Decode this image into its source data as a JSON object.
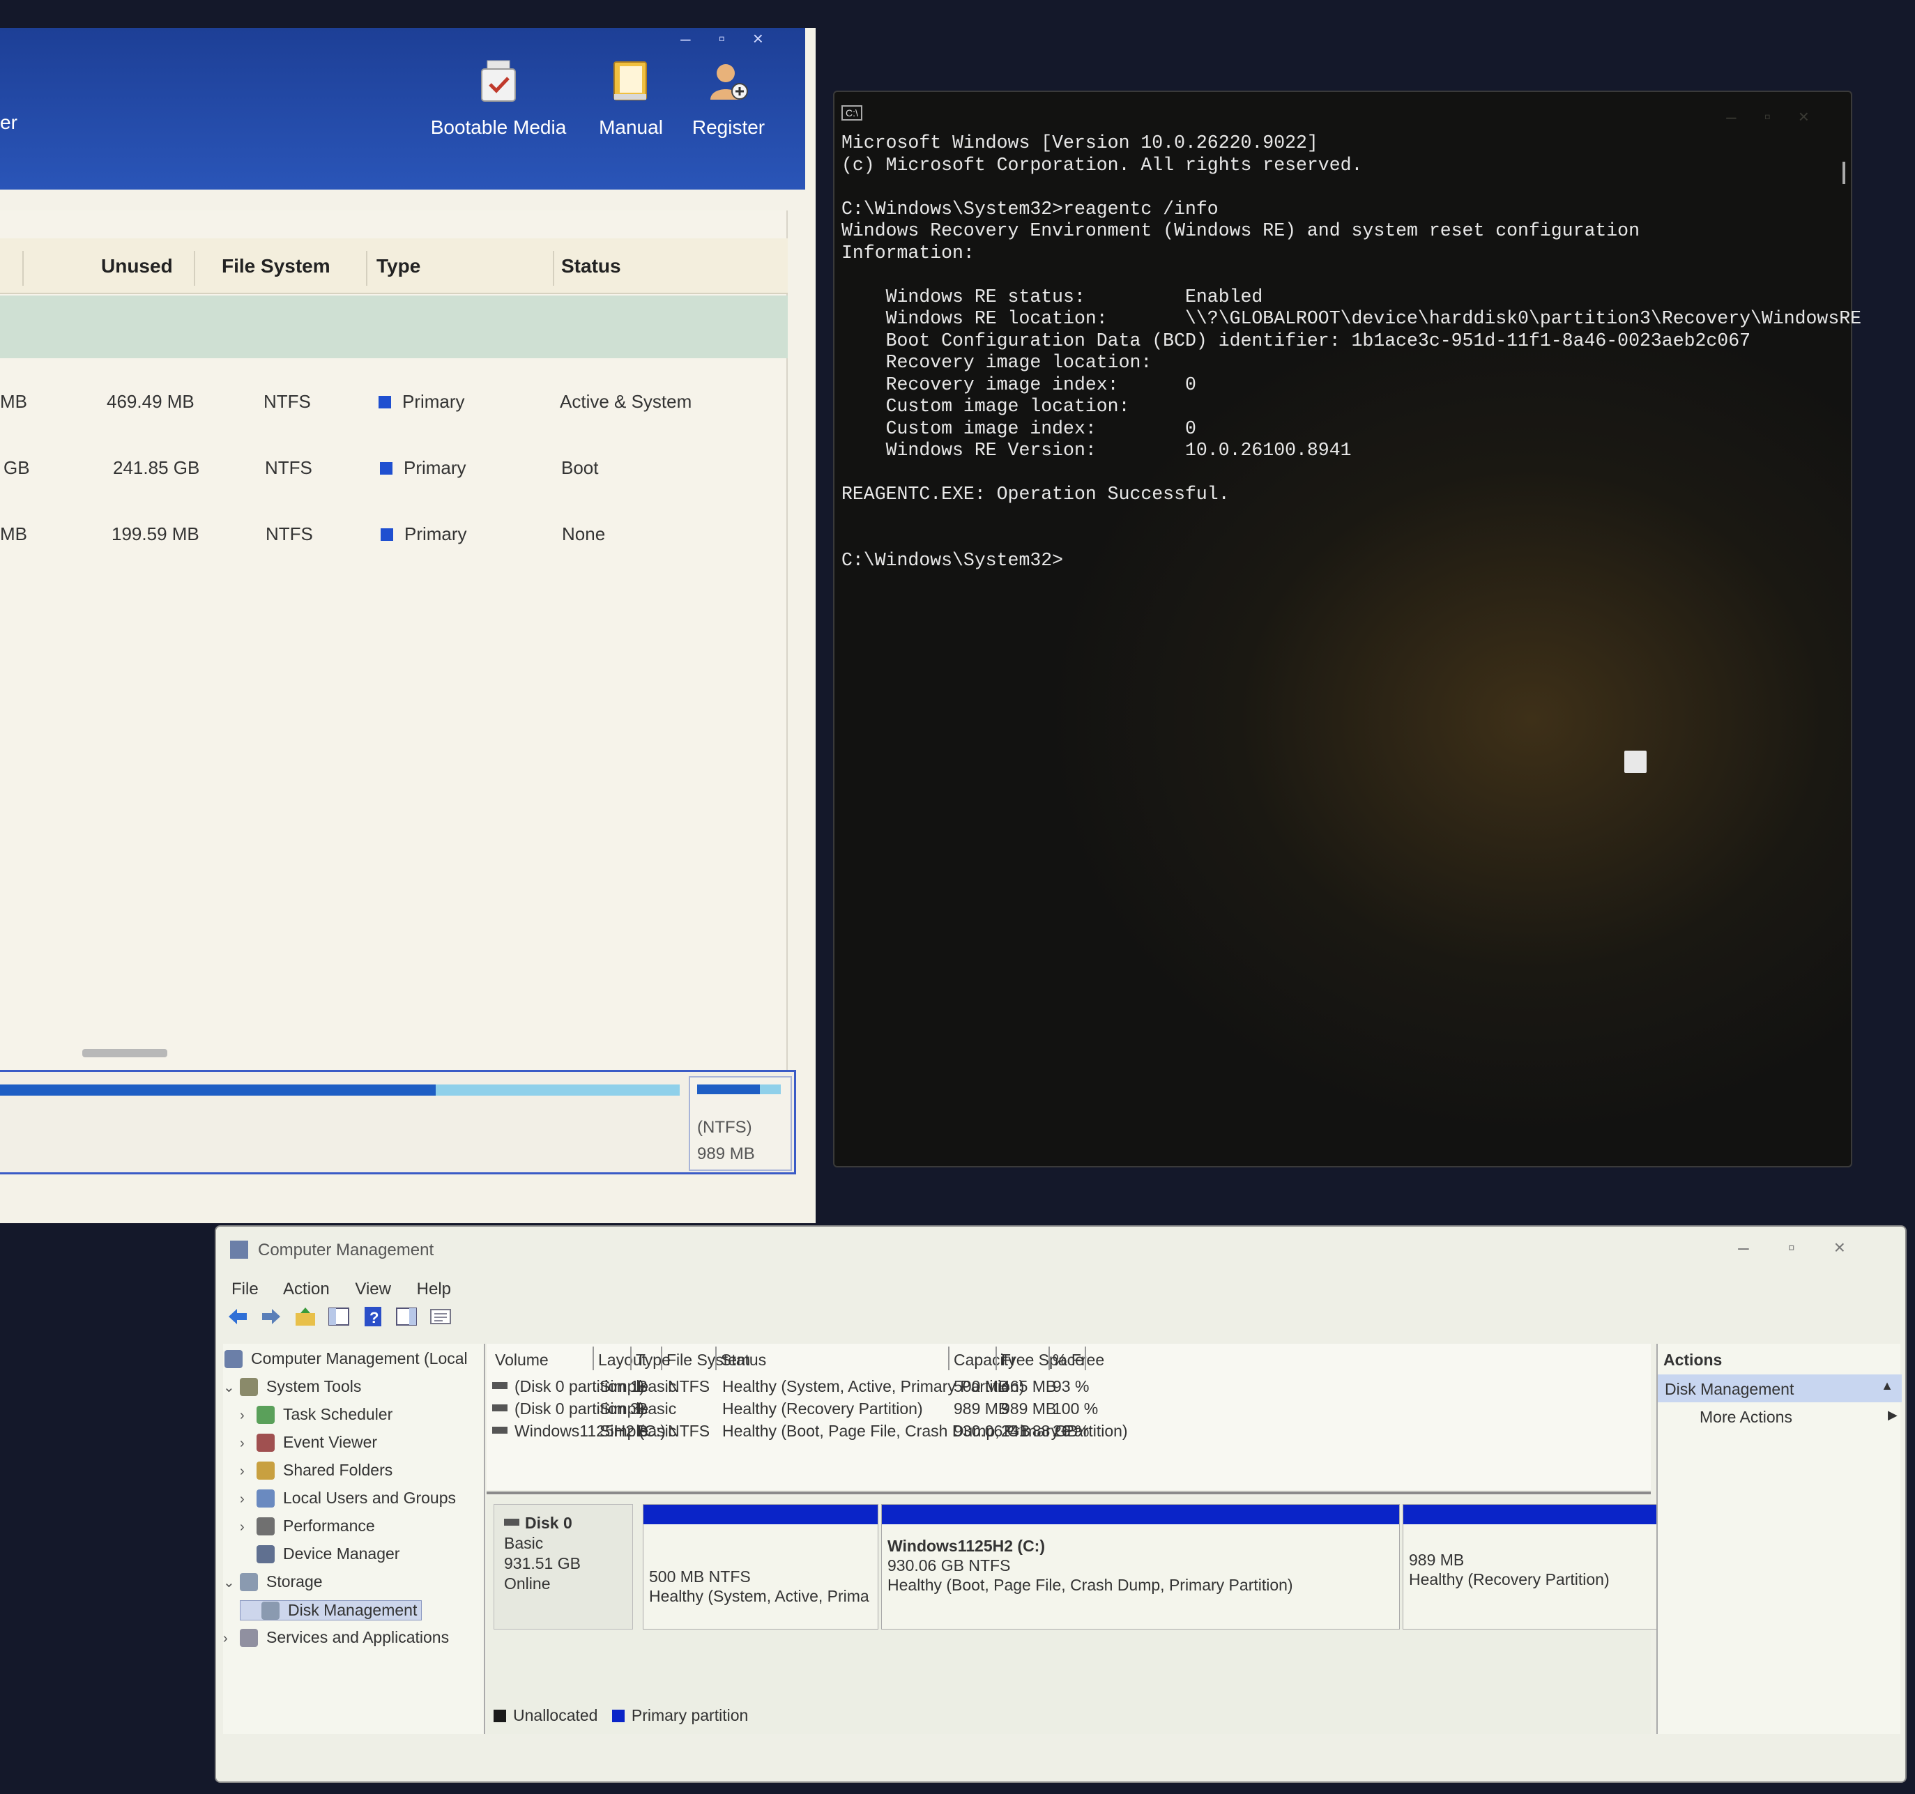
{
  "partition_tool": {
    "partial_title": "er",
    "toolbar": [
      {
        "label": "Bootable Media",
        "icon": "usb-check-icon"
      },
      {
        "label": "Manual",
        "icon": "book-icon"
      },
      {
        "label": "Register",
        "icon": "user-add-icon"
      }
    ],
    "columns": {
      "unused": "Unused",
      "file_system": "File System",
      "type": "Type",
      "status": "Status"
    },
    "rows": [
      {
        "size_frag": "MB",
        "unused": "469.49 MB",
        "fs": "NTFS",
        "type": "Primary",
        "status": "Active & System"
      },
      {
        "size_frag": "GB",
        "unused": "241.85 GB",
        "fs": "NTFS",
        "type": "Primary",
        "status": "Boot"
      },
      {
        "size_frag": "MB",
        "unused": "199.59 MB",
        "fs": "NTFS",
        "type": "Primary",
        "status": "None"
      }
    ],
    "map_card": {
      "fs": "(NTFS)",
      "size": "989 MB"
    },
    "colors": {
      "banner": "#1d3f96",
      "primary_square": "#1f4fd0"
    }
  },
  "cmd": {
    "lines": [
      "Microsoft Windows [Version 10.0.26220.9022]",
      "(c) Microsoft Corporation. All rights reserved.",
      "",
      "C:\\Windows\\System32>reagentc /info",
      "Windows Recovery Environment (Windows RE) and system reset configuration",
      "Information:",
      "",
      "    Windows RE status:         Enabled",
      "    Windows RE location:       \\\\?\\GLOBALROOT\\device\\harddisk0\\partition3\\Recovery\\WindowsRE",
      "    Boot Configuration Data (BCD) identifier: 1b1ace3c-951d-11f1-8a46-0023aeb2c067",
      "    Recovery image location:",
      "    Recovery image index:      0",
      "    Custom image location:",
      "    Custom image index:        0",
      "    Windows RE Version:        10.0.26100.8941",
      "",
      "REAGENTC.EXE: Operation Successful.",
      "",
      "",
      "C:\\Windows\\System32>"
    ]
  },
  "computer_management": {
    "title": "Computer Management",
    "menu": [
      "File",
      "Action",
      "View",
      "Help"
    ],
    "tree": [
      {
        "label": "Computer Management (Local",
        "icon": "computer-management-icon",
        "level": 0,
        "chevron": ""
      },
      {
        "label": "System Tools",
        "icon": "system-tools-icon",
        "level": 1,
        "chevron": "v"
      },
      {
        "label": "Task Scheduler",
        "icon": "clock-icon",
        "level": 2,
        "chevron": ">"
      },
      {
        "label": "Event Viewer",
        "icon": "event-viewer-icon",
        "level": 2,
        "chevron": ">"
      },
      {
        "label": "Shared Folders",
        "icon": "shared-folder-icon",
        "level": 2,
        "chevron": ">"
      },
      {
        "label": "Local Users and Groups",
        "icon": "users-icon",
        "level": 2,
        "chevron": ">"
      },
      {
        "label": "Performance",
        "icon": "performance-icon",
        "level": 2,
        "chevron": ">"
      },
      {
        "label": "Device Manager",
        "icon": "device-manager-icon",
        "level": 2,
        "chevron": ""
      },
      {
        "label": "Storage",
        "icon": "storage-icon",
        "level": 1,
        "chevron": "v"
      },
      {
        "label": "Disk Management",
        "icon": "disk-management-icon",
        "level": 2,
        "chevron": ""
      },
      {
        "label": "Services and Applications",
        "icon": "services-icon",
        "level": 1,
        "chevron": ">"
      }
    ],
    "volume_columns": [
      "Volume",
      "Layout",
      "Type",
      "File System",
      "Status",
      "Capacity",
      "Free Space",
      "% Free"
    ],
    "volumes": [
      {
        "volume": "(Disk 0 partition 1)",
        "layout": "Simple",
        "type": "Basic",
        "fs": "NTFS",
        "status": "Healthy (System, Active, Primary Partition)",
        "capacity": "500 MB",
        "free": "465 MB",
        "pct": "93 %"
      },
      {
        "volume": "(Disk 0 partition 3)",
        "layout": "Simple",
        "type": "Basic",
        "fs": "",
        "status": "Healthy (Recovery Partition)",
        "capacity": "989 MB",
        "free": "989 MB",
        "pct": "100 %"
      },
      {
        "volume": "Windows1125H2 (C:)",
        "layout": "Simple",
        "type": "Basic",
        "fs": "NTFS",
        "status": "Healthy (Boot, Page File, Crash Dump, Primary Partition)",
        "capacity": "930.06 GB",
        "free": "241.88 GB",
        "pct": "26 %"
      }
    ],
    "disk": {
      "name": "Disk 0",
      "kind": "Basic",
      "size": "931.51 GB",
      "state": "Online"
    },
    "partitions": [
      {
        "name": "",
        "line1": "500 MB NTFS",
        "line2": "Healthy (System, Active, Prima"
      },
      {
        "name": "Windows1125H2  (C:)",
        "line1": "930.06 GB NTFS",
        "line2": "Healthy (Boot, Page File, Crash Dump, Primary Partition)"
      },
      {
        "name": "",
        "line1": "989 MB",
        "line2": "Healthy (Recovery Partition)"
      }
    ],
    "legend": [
      {
        "label": "Unallocated",
        "color": "#1a1a1a"
      },
      {
        "label": "Primary partition",
        "color": "#0a24c8"
      }
    ],
    "actions": {
      "header": "Actions",
      "selected": "Disk Management",
      "more": "More Actions"
    }
  }
}
